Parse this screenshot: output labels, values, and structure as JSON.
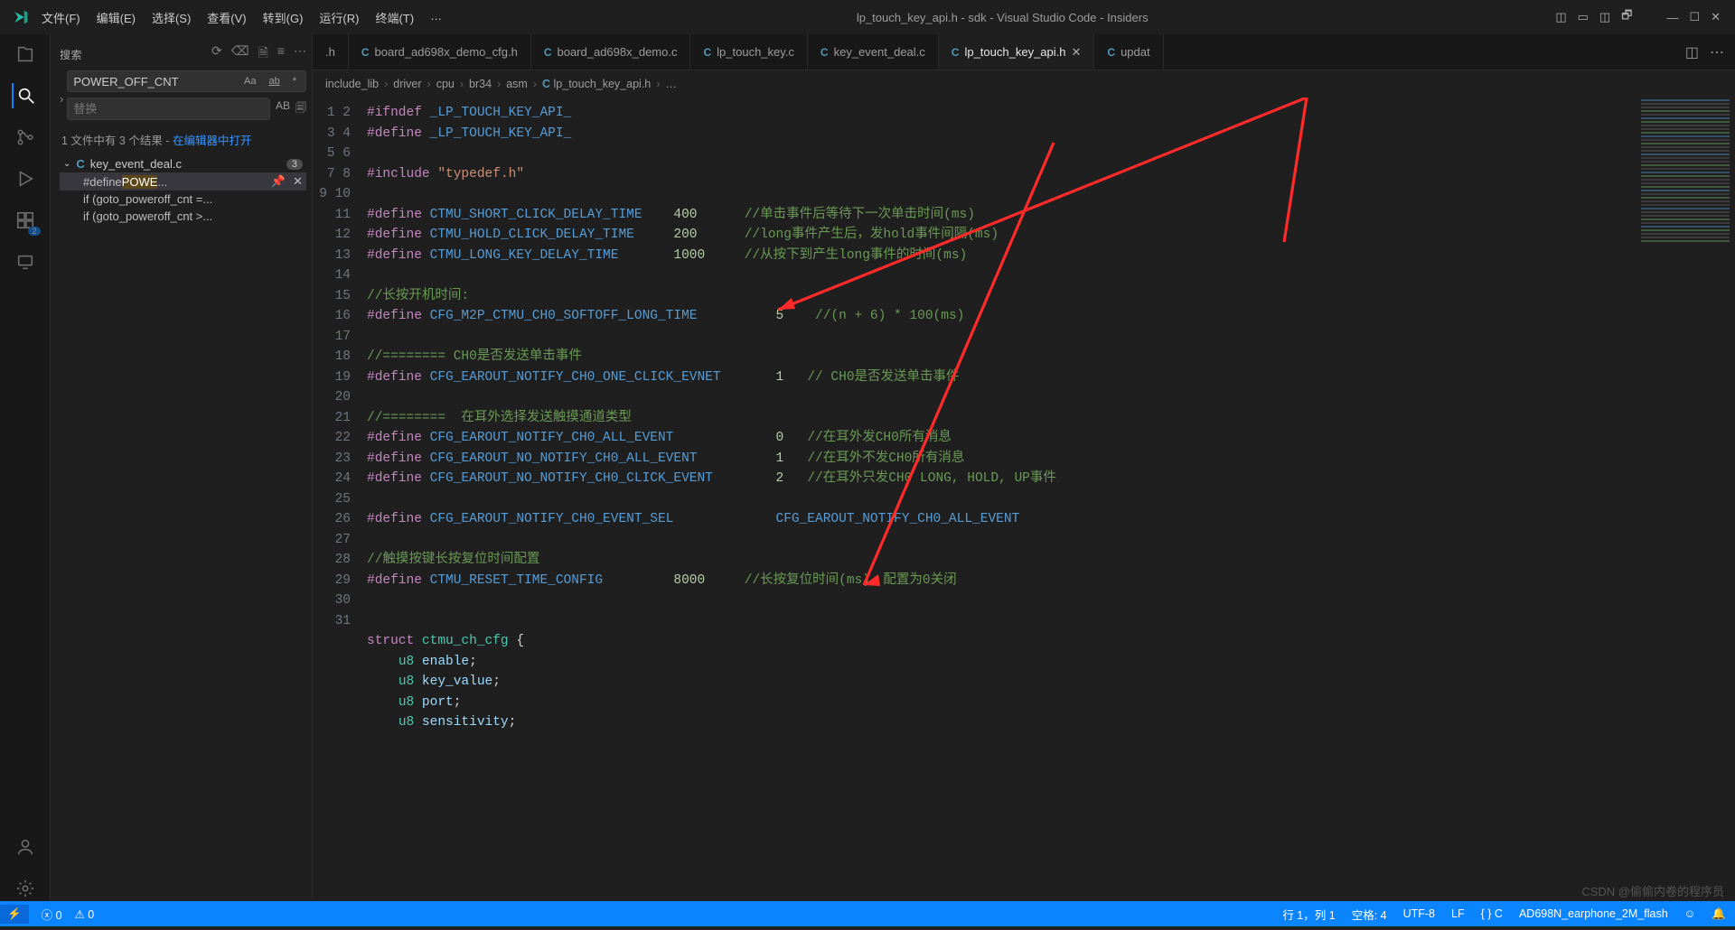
{
  "title": "lp_touch_key_api.h - sdk - Visual Studio Code - Insiders",
  "menu": {
    "file": "文件(F)",
    "edit": "编辑(E)",
    "sel": "选择(S)",
    "view": "查看(V)",
    "goto": "转到(G)",
    "run": "运行(R)",
    "term": "终端(T)",
    "more": "…"
  },
  "search": {
    "label": "搜索",
    "query": "POWER_OFF_CNT",
    "replace_placeholder": "替换",
    "opts": {
      "case": "Aa",
      "word": "ab",
      "regex": "*",
      "ab": "AB"
    },
    "results_meta_pre": "1 文件中有 3 个结果 - ",
    "results_meta_link": "在编辑器中打开",
    "file": "key_event_deal.c",
    "file_lang": "C",
    "file_count": "3",
    "matches": [
      {
        "pre": "#define ",
        "hl": "POWE",
        "post": "..."
      },
      {
        "pre": "if (goto_poweroff_cnt =",
        "hl": "",
        "post": "..."
      },
      {
        "pre": "if (goto_poweroff_cnt >",
        "hl": "",
        "post": "..."
      }
    ]
  },
  "tabs": [
    {
      "lang": "",
      "name": ".h",
      "active": false
    },
    {
      "lang": "C",
      "name": "board_ad698x_demo_cfg.h",
      "active": false
    },
    {
      "lang": "C",
      "name": "board_ad698x_demo.c",
      "active": false
    },
    {
      "lang": "C",
      "name": "lp_touch_key.c",
      "active": false
    },
    {
      "lang": "C",
      "name": "key_event_deal.c",
      "active": false
    },
    {
      "lang": "C",
      "name": "lp_touch_key_api.h",
      "active": true
    },
    {
      "lang": "C",
      "name": "updat",
      "active": false
    }
  ],
  "breadcrumb": [
    "include_lib",
    "driver",
    "cpu",
    "br34",
    "asm",
    "lp_touch_key_api.h",
    "…"
  ],
  "breadcrumb_lang": "C",
  "code": {
    "lines": [
      {
        "n": 1,
        "seg": [
          [
            "def",
            "#ifndef "
          ],
          [
            "mac",
            "_LP_TOUCH_KEY_API_"
          ]
        ]
      },
      {
        "n": 2,
        "seg": [
          [
            "def",
            "#define "
          ],
          [
            "mac",
            "_LP_TOUCH_KEY_API_"
          ]
        ]
      },
      {
        "n": 3,
        "seg": [
          [
            "",
            "​"
          ]
        ]
      },
      {
        "n": 4,
        "seg": [
          [
            "def",
            "#include "
          ],
          [
            "str",
            "\"typedef.h\""
          ]
        ]
      },
      {
        "n": 5,
        "seg": [
          [
            "",
            "​"
          ]
        ]
      },
      {
        "n": 6,
        "seg": [
          [
            "def",
            "#define "
          ],
          [
            "mac",
            "CTMU_SHORT_CLICK_DELAY_TIME"
          ],
          [
            "",
            "    "
          ],
          [
            "num",
            "400"
          ],
          [
            "",
            "      "
          ],
          [
            "cmt",
            "//单击事件后等待下一次单击时间(ms)"
          ]
        ]
      },
      {
        "n": 7,
        "seg": [
          [
            "def",
            "#define "
          ],
          [
            "mac",
            "CTMU_HOLD_CLICK_DELAY_TIME"
          ],
          [
            "",
            "     "
          ],
          [
            "num",
            "200"
          ],
          [
            "",
            "      "
          ],
          [
            "cmt",
            "//long事件产生后，发hold事件间隔(ms)"
          ]
        ]
      },
      {
        "n": 8,
        "seg": [
          [
            "def",
            "#define "
          ],
          [
            "mac",
            "CTMU_LONG_KEY_DELAY_TIME"
          ],
          [
            "",
            "       "
          ],
          [
            "num",
            "1000"
          ],
          [
            "",
            "     "
          ],
          [
            "cmt",
            "//从按下到产生long事件的时间(ms)"
          ]
        ]
      },
      {
        "n": 9,
        "seg": [
          [
            "",
            "​"
          ]
        ]
      },
      {
        "n": 10,
        "seg": [
          [
            "cmt",
            "//长按开机时间:"
          ]
        ]
      },
      {
        "n": 11,
        "seg": [
          [
            "def",
            "#define "
          ],
          [
            "mac",
            "CFG_M2P_CTMU_CH0_SOFTOFF_LONG_TIME"
          ],
          [
            "",
            "          "
          ],
          [
            "num",
            "5"
          ],
          [
            "",
            "    "
          ],
          [
            "cmt",
            "//(n + 6) * 100(ms)"
          ]
        ]
      },
      {
        "n": 12,
        "seg": [
          [
            "",
            "​"
          ]
        ]
      },
      {
        "n": 13,
        "seg": [
          [
            "cmt",
            "//======== CH0是否发送单击事件"
          ]
        ]
      },
      {
        "n": 14,
        "seg": [
          [
            "def",
            "#define "
          ],
          [
            "mac",
            "CFG_EAROUT_NOTIFY_CH0_ONE_CLICK_EVNET"
          ],
          [
            "",
            "       "
          ],
          [
            "num",
            "1"
          ],
          [
            "",
            "   "
          ],
          [
            "cmt",
            "// CH0是否发送单击事件"
          ]
        ]
      },
      {
        "n": 15,
        "seg": [
          [
            "",
            "​"
          ]
        ]
      },
      {
        "n": 16,
        "seg": [
          [
            "cmt",
            "//========  在耳外选择发送触摸通道类型"
          ]
        ]
      },
      {
        "n": 17,
        "seg": [
          [
            "def",
            "#define "
          ],
          [
            "mac",
            "CFG_EAROUT_NOTIFY_CH0_ALL_EVENT"
          ],
          [
            "",
            "             "
          ],
          [
            "num",
            "0"
          ],
          [
            "",
            "   "
          ],
          [
            "cmt",
            "//在耳外发CH0所有消息"
          ]
        ]
      },
      {
        "n": 18,
        "seg": [
          [
            "def",
            "#define "
          ],
          [
            "mac",
            "CFG_EAROUT_NO_NOTIFY_CH0_ALL_EVENT"
          ],
          [
            "",
            "          "
          ],
          [
            "num",
            "1"
          ],
          [
            "",
            "   "
          ],
          [
            "cmt",
            "//在耳外不发CH0所有消息"
          ]
        ]
      },
      {
        "n": 19,
        "seg": [
          [
            "def",
            "#define "
          ],
          [
            "mac",
            "CFG_EAROUT_NO_NOTIFY_CH0_CLICK_EVENT"
          ],
          [
            "",
            "        "
          ],
          [
            "num",
            "2"
          ],
          [
            "",
            "   "
          ],
          [
            "cmt",
            "//在耳外只发CH0 LONG, HOLD, UP事件"
          ]
        ]
      },
      {
        "n": 20,
        "seg": [
          [
            "",
            "​"
          ]
        ]
      },
      {
        "n": 21,
        "seg": [
          [
            "def",
            "#define "
          ],
          [
            "mac",
            "CFG_EAROUT_NOTIFY_CH0_EVENT_SEL"
          ],
          [
            "",
            "             "
          ],
          [
            "mac",
            "CFG_EAROUT_NOTIFY_CH0_ALL_EVENT"
          ]
        ]
      },
      {
        "n": 22,
        "seg": [
          [
            "",
            "​"
          ]
        ]
      },
      {
        "n": 23,
        "seg": [
          [
            "cmt",
            "//触摸按键长按复位时间配置"
          ]
        ]
      },
      {
        "n": 24,
        "seg": [
          [
            "def",
            "#define "
          ],
          [
            "mac",
            "CTMU_RESET_TIME_CONFIG"
          ],
          [
            "",
            "         "
          ],
          [
            "num",
            "8000"
          ],
          [
            "",
            "     "
          ],
          [
            "cmt",
            "//长按复位时间(ms)，配置为0关闭"
          ]
        ]
      },
      {
        "n": 25,
        "seg": [
          [
            "",
            "​"
          ]
        ]
      },
      {
        "n": 26,
        "seg": [
          [
            "",
            "​"
          ]
        ]
      },
      {
        "n": 27,
        "seg": [
          [
            "kw",
            "struct "
          ],
          [
            "typ",
            "ctmu_ch_cfg"
          ],
          [
            "",
            " {"
          ]
        ]
      },
      {
        "n": 28,
        "seg": [
          [
            "",
            "    "
          ],
          [
            "typ",
            "u8 "
          ],
          [
            "fld",
            "enable"
          ],
          [
            "",
            ";"
          ]
        ]
      },
      {
        "n": 29,
        "seg": [
          [
            "",
            "    "
          ],
          [
            "typ",
            "u8 "
          ],
          [
            "fld",
            "key_value"
          ],
          [
            "",
            ";"
          ]
        ]
      },
      {
        "n": 30,
        "seg": [
          [
            "",
            "    "
          ],
          [
            "typ",
            "u8 "
          ],
          [
            "fld",
            "port"
          ],
          [
            "",
            ";"
          ]
        ]
      },
      {
        "n": 31,
        "seg": [
          [
            "",
            "    "
          ],
          [
            "typ",
            "u8 "
          ],
          [
            "fld",
            "sensitivity"
          ],
          [
            "",
            ";"
          ]
        ]
      }
    ]
  },
  "status": {
    "errors": "0",
    "warnings": "0",
    "ln": "行 1，列 1",
    "spaces": "空格: 4",
    "enc": "UTF-8",
    "eol": "LF",
    "lang": "C",
    "lang_brace": "{ }",
    "target": "AD698N_earphone_2M_flash",
    "bell": "🔔"
  },
  "watermark": "CSDN @偷偷内卷的程序员"
}
